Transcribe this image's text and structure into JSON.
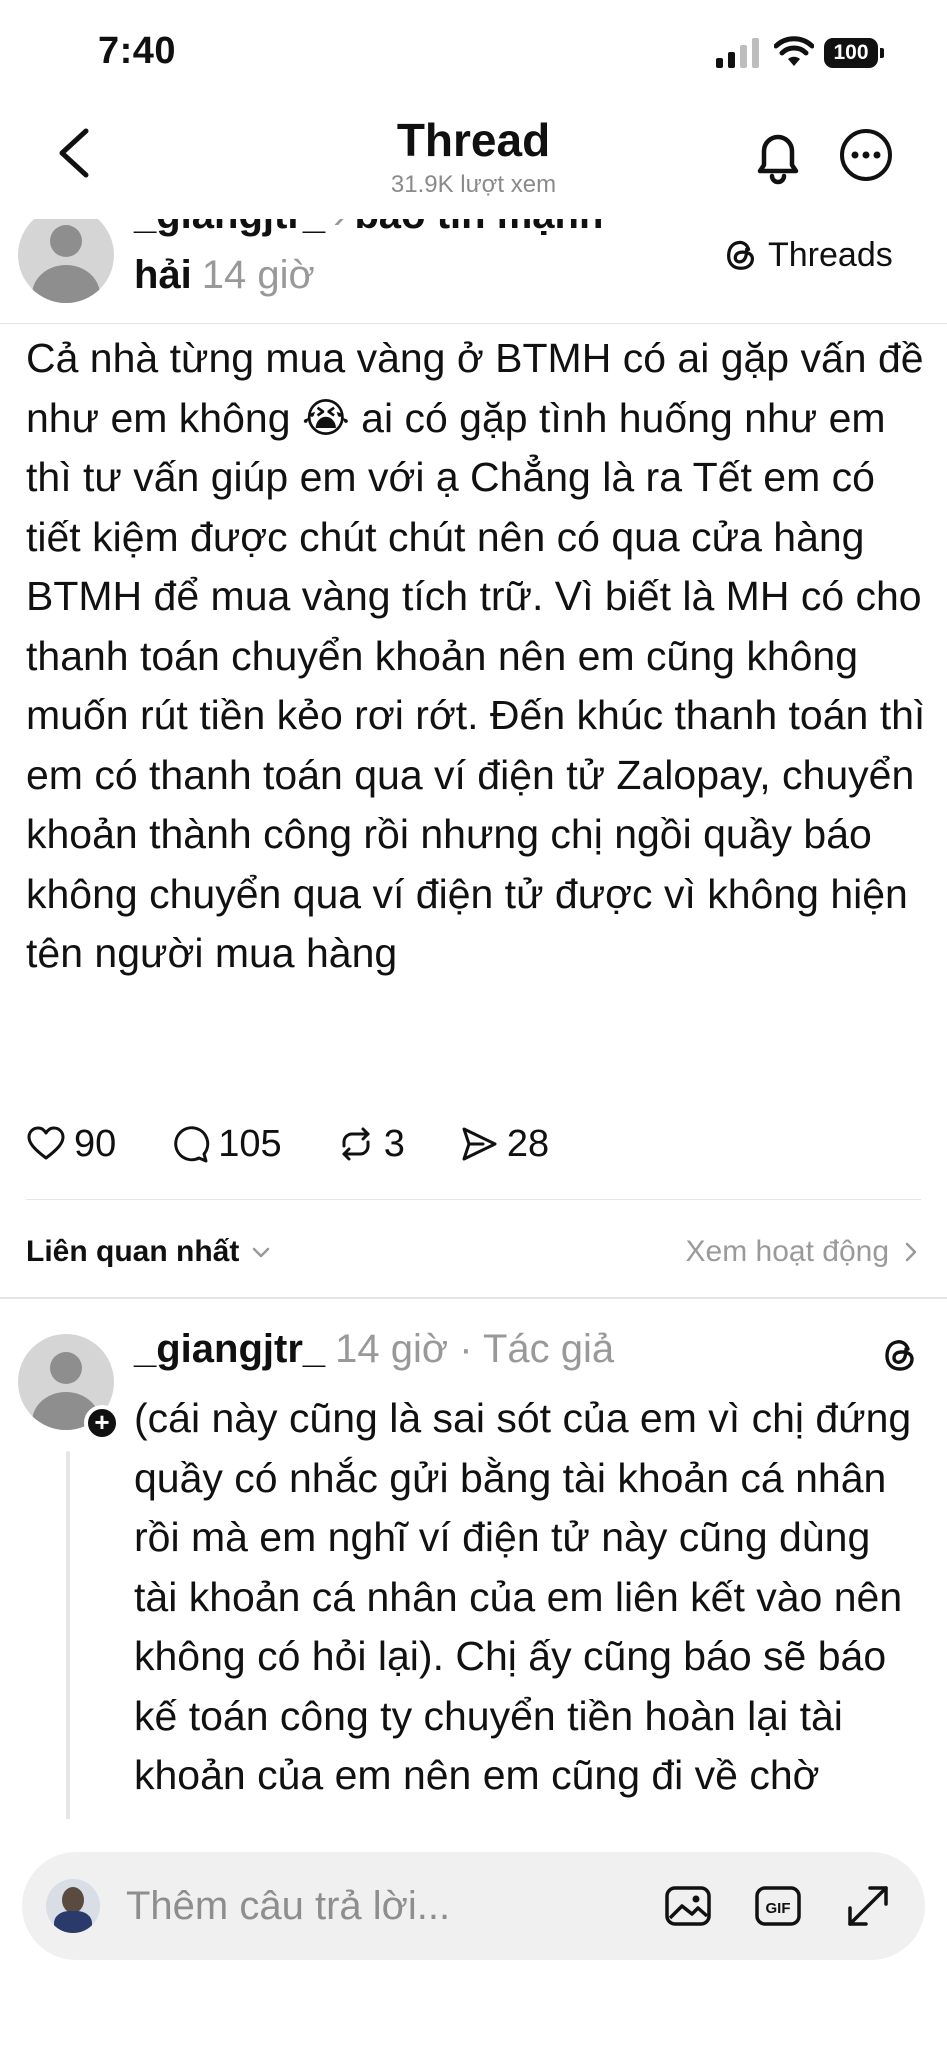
{
  "status_bar": {
    "time": "7:40",
    "battery": "100"
  },
  "header": {
    "title": "Thread",
    "subtitle": "31.9K lượt xem",
    "icons": [
      "back-icon",
      "bell-icon",
      "more-icon"
    ]
  },
  "post": {
    "username": "_giangjtr_",
    "community": "báo tin mạnh",
    "community_continued": "hải",
    "time": "14 giờ",
    "badge": "Threads",
    "body": "Cả nhà từng mua vàng ở BTMH có ai gặp vấn đề như em không 😭 ai có gặp tình huống như em thì tư vấn giúp em với ạ Chẳng là ra Tết em có tiết kiệm được chút chút nên có qua cửa hàng BTMH để mua vàng tích trữ. Vì biết là MH có cho thanh toán chuyển khoản nên em cũng không muốn rút tiền kẻo rơi rớt. Đến khúc thanh toán thì em có thanh toán qua ví điện tử Zalopay, chuyển khoản thành công rồi nhưng chị ngồi quầy báo không chuyển qua ví điện tử được vì không hiện tên người mua hàng",
    "actions": {
      "likes": "90",
      "replies": "105",
      "reposts": "3",
      "shares": "28"
    }
  },
  "sort": {
    "label": "Liên quan nhất",
    "activity_link": "Xem hoạt động"
  },
  "reply": {
    "username": "_giangjtr_",
    "meta": "14 giờ · Tác giả",
    "body": "(cái này cũng là sai sót của em vì chị đứng quầy có nhắc gửi bằng tài khoản cá nhân rồi mà em nghĩ ví điện tử này cũng dùng tài khoản cá nhân của em liên kết vào nên không có hỏi lại). Chị ấy cũng báo sẽ báo kế toán công ty chuyển tiền hoàn lại tài khoản của em nên em cũng đi về chờ thông tin. Sau"
  },
  "composer": {
    "placeholder": "Thêm câu trả lời..."
  },
  "colors": {
    "text": "#101010",
    "muted": "#999999",
    "divider": "#e3e3e3",
    "composer_bg": "#f0f0f0"
  }
}
